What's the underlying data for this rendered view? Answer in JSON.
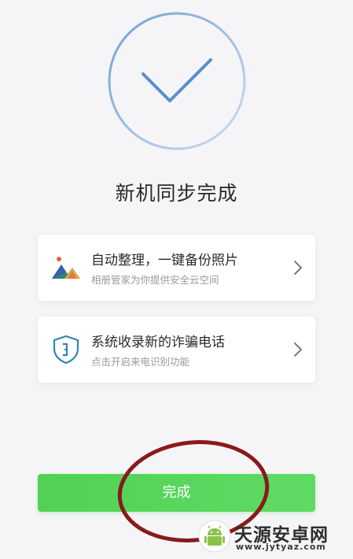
{
  "page": {
    "title": "新机同步完成"
  },
  "cards": [
    {
      "title": "自动整理，一键备份照片",
      "subtitle": "相册管家为你提供安全云空间",
      "icon": "photo-mountain-icon"
    },
    {
      "title": "系统收录新的诈骗电话",
      "subtitle": "点击开启来电识别功能",
      "icon": "shield-phone-icon"
    }
  ],
  "done_button": {
    "label": "完成"
  },
  "watermark": {
    "title": "天源安卓网",
    "url": "www.jytyaz.com"
  },
  "colors": {
    "background": "#f5f5f7",
    "circle_gradient_start": "#7aa8d8",
    "circle_gradient_end": "#c9d8ef",
    "check": "#5a8fc9",
    "button_green": "#55d359",
    "annotation_red": "#8a1a1a",
    "shield_blue": "#2e86b8"
  }
}
